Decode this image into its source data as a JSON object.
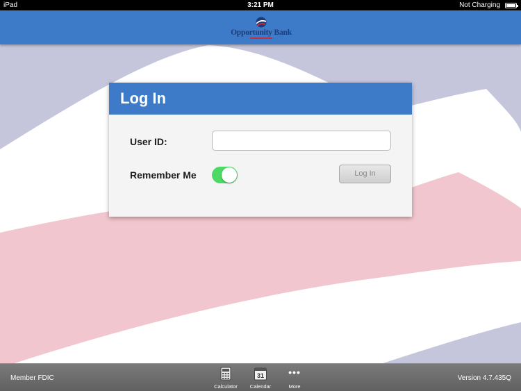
{
  "status_bar": {
    "device": "iPad",
    "time": "3:21 PM",
    "charging": "Not Charging"
  },
  "header": {
    "logo_text": "Opportunity Bank"
  },
  "login": {
    "title": "Log In",
    "user_id_label": "User ID:",
    "user_id_value": "",
    "remember_label": "Remember Me",
    "remember_on": true,
    "submit_label": "Log In"
  },
  "footer": {
    "left_text": "Member FDIC",
    "version": "Version 4.7.435Q",
    "tools": [
      {
        "label": "Calculator",
        "icon": "calculator-icon"
      },
      {
        "label": "Calendar",
        "icon": "calendar-icon",
        "day": "31"
      },
      {
        "label": "More",
        "icon": "more-icon"
      }
    ]
  },
  "colors": {
    "brand_blue": "#3d7bc8",
    "toggle_green": "#4cd964",
    "background_lavender": "#c5c6dc",
    "background_pink": "#f2c6ce"
  }
}
